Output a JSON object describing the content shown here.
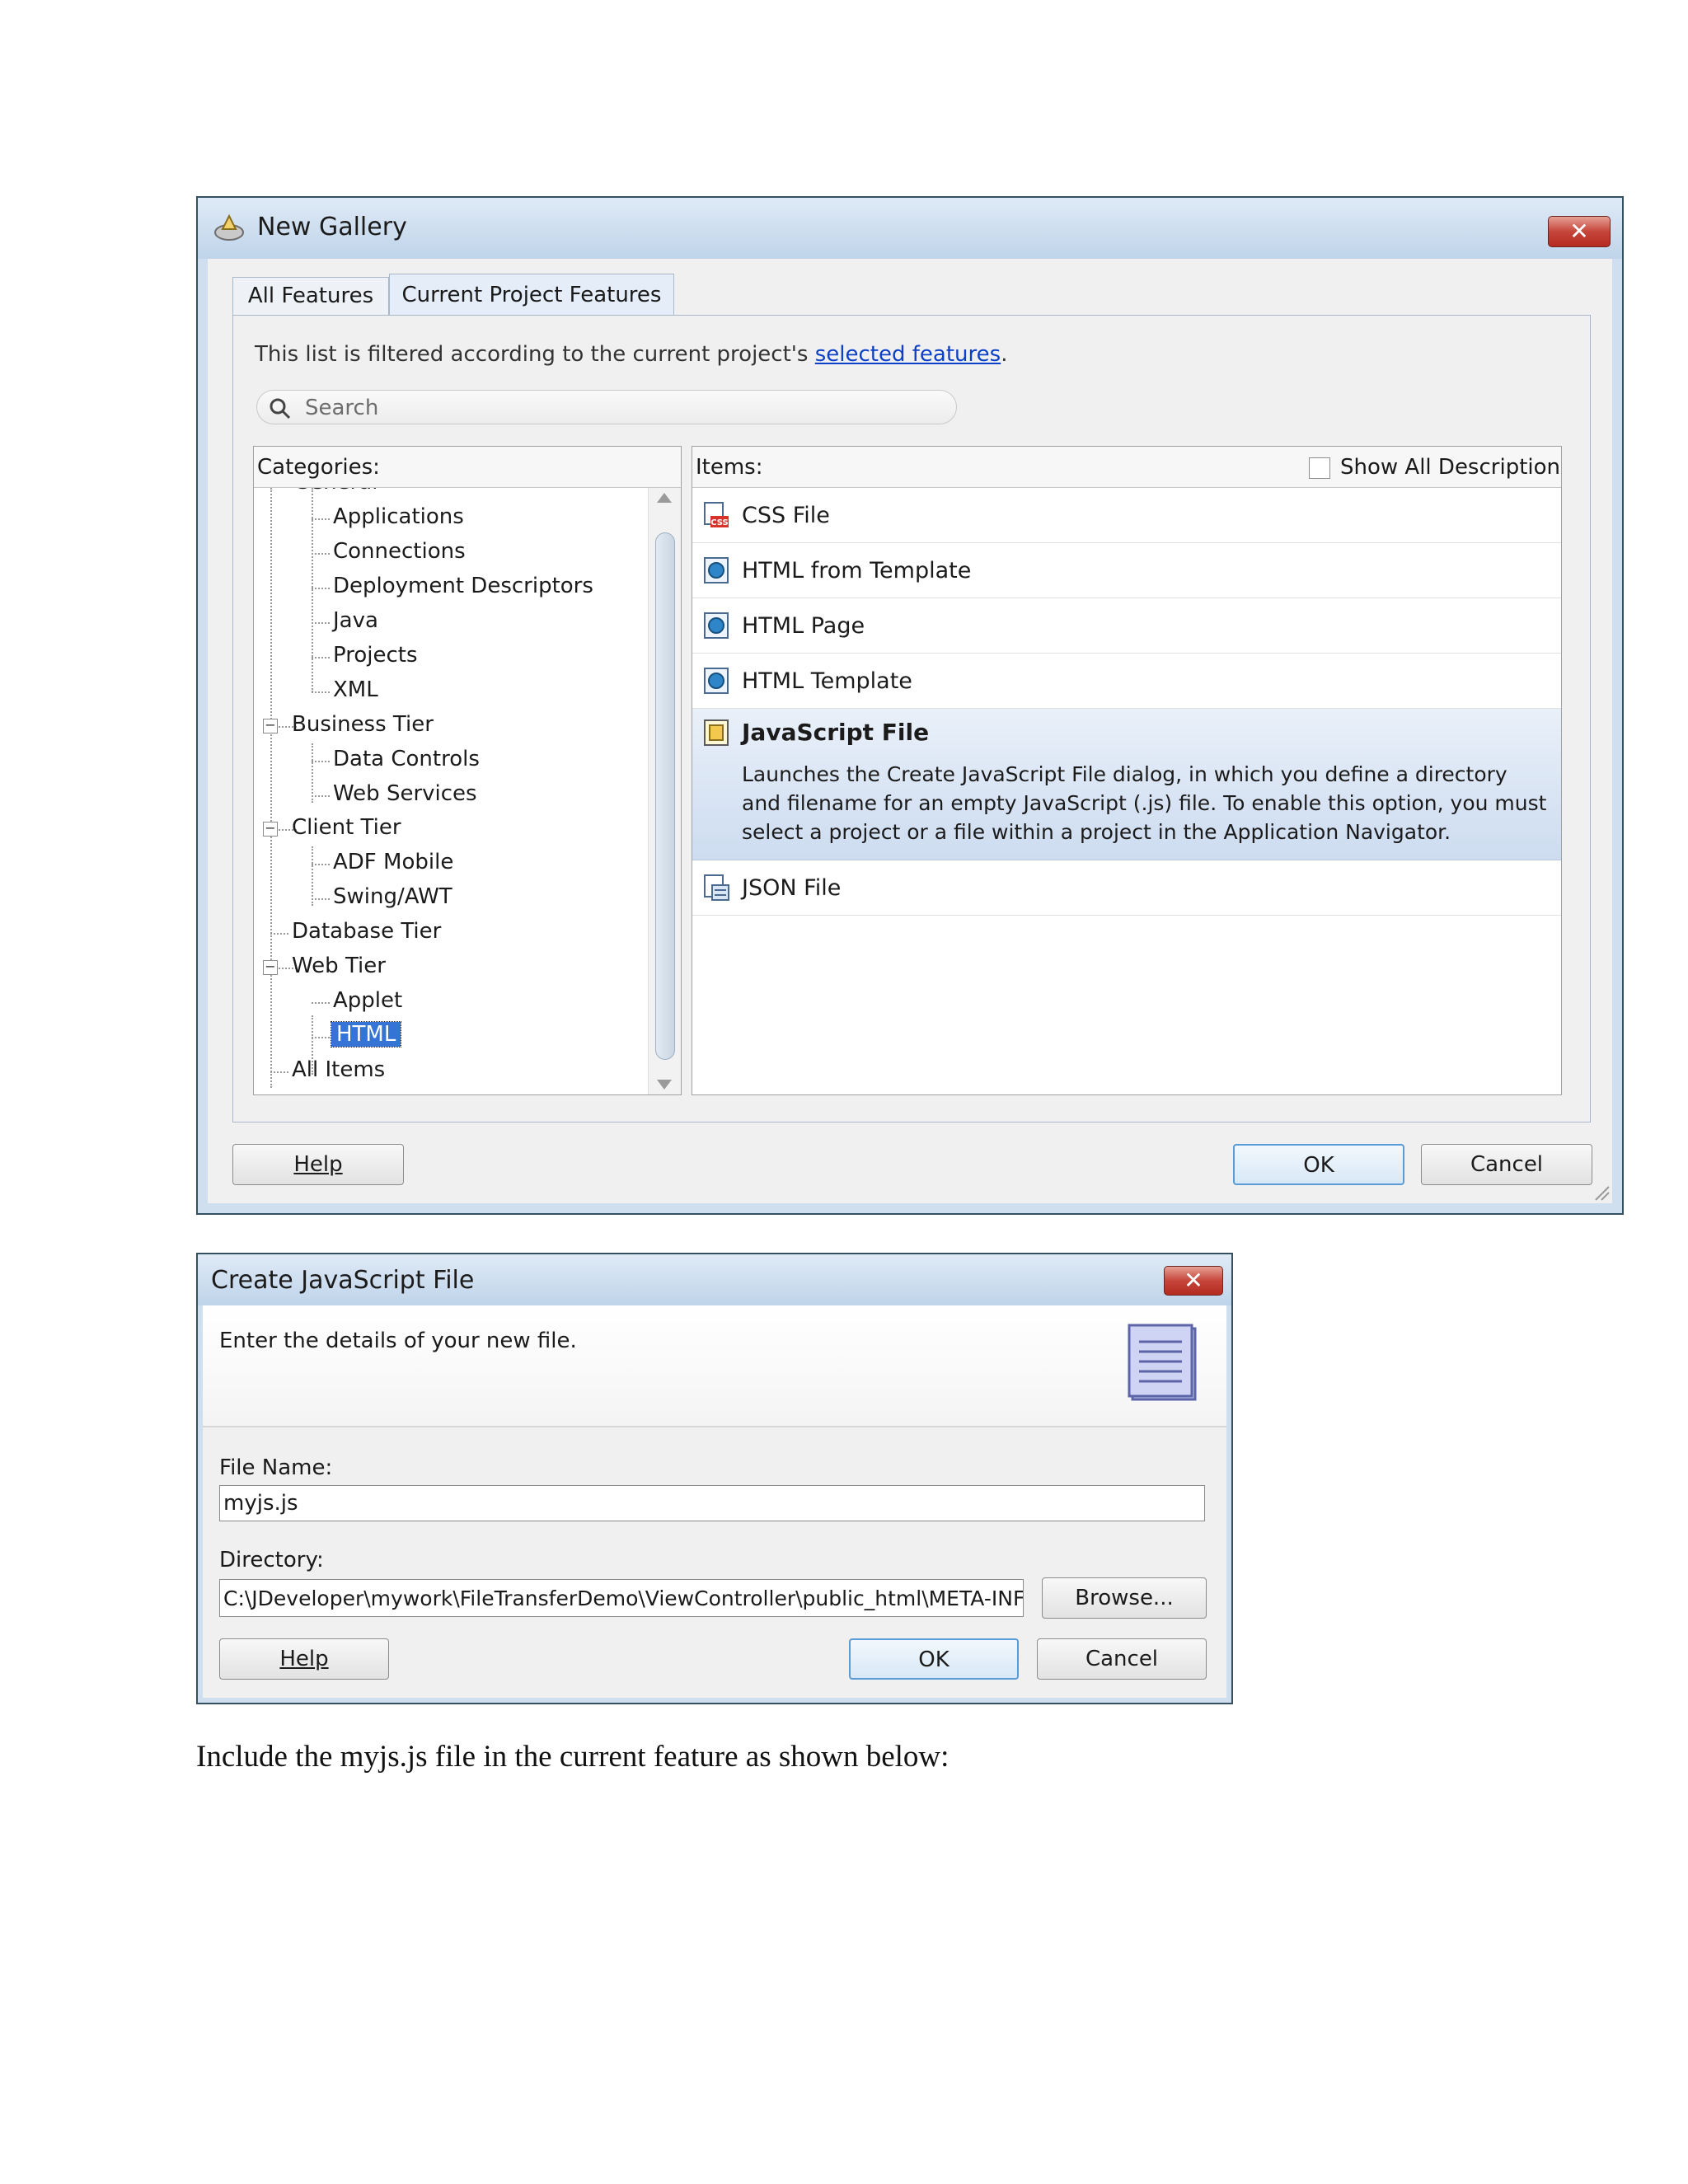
{
  "new_gallery": {
    "title": "New Gallery",
    "tabs": [
      {
        "label": "All Features",
        "active": false
      },
      {
        "label": "Current Project Features",
        "active": true
      }
    ],
    "filter_text": "This list is filtered according to the current project's ",
    "filter_link": "selected features",
    "filter_end": ".",
    "search_placeholder": "Search",
    "categories_header": "Categories:",
    "items_header": "Items:",
    "show_all_desc": "Show All Descriptions",
    "categories": {
      "general_clipped": "General",
      "general_children": [
        "Applications",
        "Connections",
        "Deployment Descriptors",
        "Java",
        "Projects",
        "XML"
      ],
      "business_tier": "Business Tier",
      "business_children": [
        "Data Controls",
        "Web Services"
      ],
      "client_tier": "Client Tier",
      "client_children": [
        "ADF Mobile",
        "Swing/AWT"
      ],
      "database_tier": "Database Tier",
      "web_tier": "Web Tier",
      "web_children": [
        "Applet",
        "HTML"
      ],
      "all_items": "All Items",
      "selected": "HTML"
    },
    "items": [
      {
        "label": "CSS File"
      },
      {
        "label": "HTML from Template"
      },
      {
        "label": "HTML Page"
      },
      {
        "label": "HTML Template"
      },
      {
        "label": "JavaScript File",
        "description": "Launches the Create JavaScript File dialog, in which you define a directory and filename for an empty JavaScript (.js) file. To enable this option, you must select a project or a file within a project in the Application Navigator."
      },
      {
        "label": "JSON File"
      }
    ],
    "buttons": {
      "help": "Help",
      "ok": "OK",
      "cancel": "Cancel"
    }
  },
  "create_js": {
    "title": "Create JavaScript File",
    "intro": "Enter the details of your new file.",
    "file_name_label": "File Name:",
    "file_name_value": "myjs.js",
    "directory_label": "Directory:",
    "directory_value": "C:\\JDeveloper\\mywork\\FileTransferDemo\\ViewController\\public_html\\META-INF",
    "browse": "Browse...",
    "buttons": {
      "help": "Help",
      "ok": "OK",
      "cancel": "Cancel"
    }
  },
  "caption": "Include the myjs.js file in the current feature as shown below:"
}
